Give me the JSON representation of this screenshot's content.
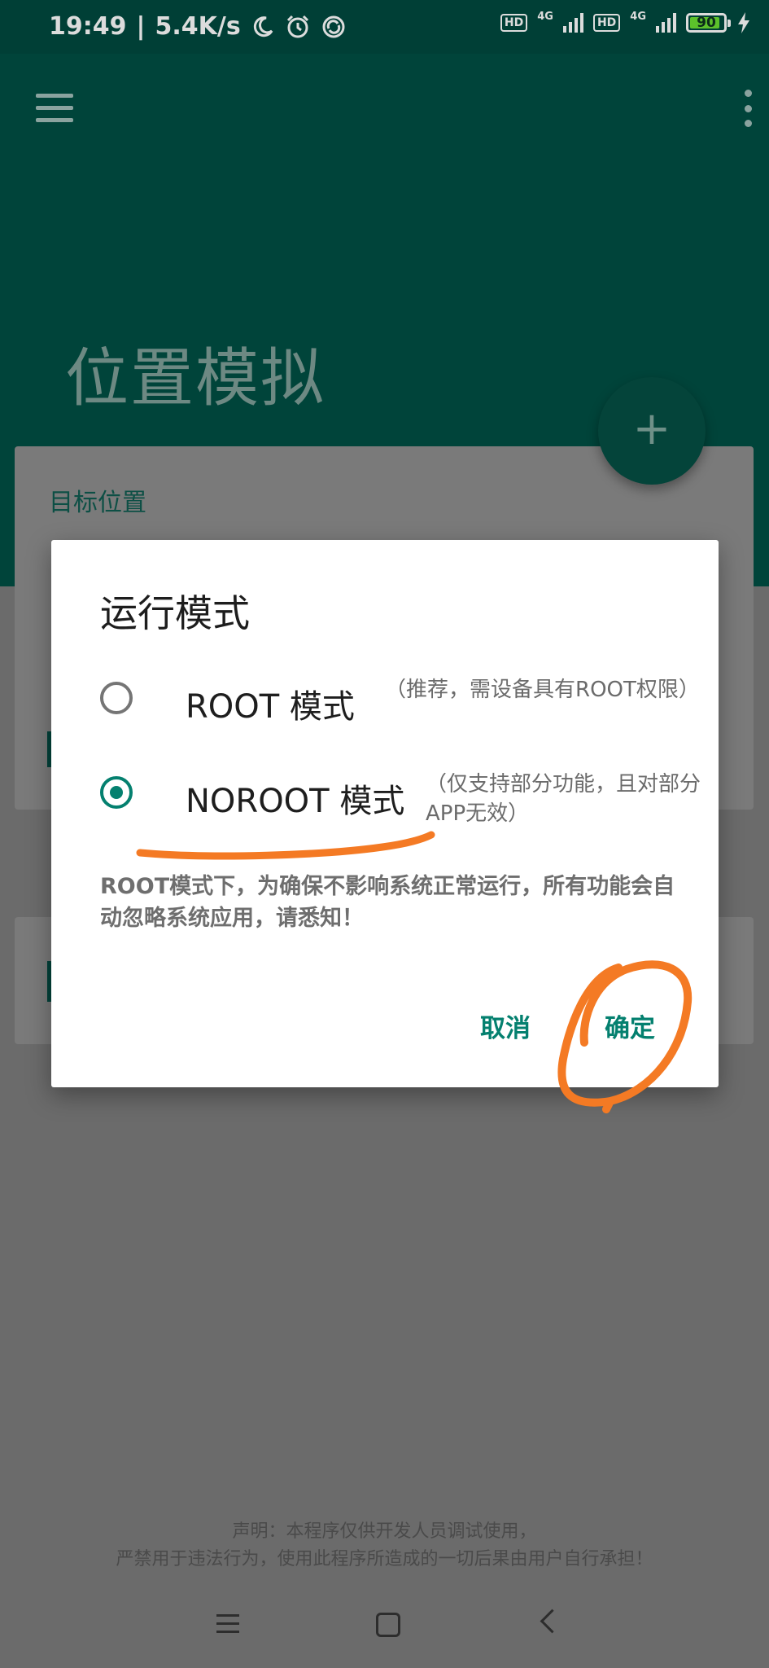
{
  "status_bar": {
    "time": "19:49",
    "speed": "5.4K/s",
    "sim1_badge": "HD",
    "sim1_net": "4G",
    "sim2_badge": "HD",
    "sim2_net": "4G",
    "battery": "90",
    "battery_level": 0.9,
    "icons": [
      "moon-icon",
      "alarm-icon",
      "sync-icon",
      "charging-icon"
    ]
  },
  "appbar": {
    "title": "位置模拟",
    "menu_icon": "hamburger-menu-icon",
    "more_icon": "more-vert-icon"
  },
  "card": {
    "title": "目标位置"
  },
  "fab": {
    "label": "+"
  },
  "dialog": {
    "title": "运行模式",
    "options": [
      {
        "label": "ROOT 模式",
        "desc": "（推荐，需设备具有ROOT权限）",
        "checked": false
      },
      {
        "label": "NOROOT 模式",
        "desc": "（仅支持部分功能，且对部分APP无效）",
        "checked": true
      }
    ],
    "note": "ROOT模式下，为确保不影响系统正常运行，所有功能会自动忽略系统应用，请悉知！",
    "cancel_label": "取消",
    "ok_label": "确定"
  },
  "disclaimer": {
    "line1": "声明：本程序仅供开发人员调试使用，",
    "line2": "严禁用于违法行为，使用此程序所造成的一切后果由用户自行承担！"
  },
  "colors": {
    "primary": "#00443a",
    "accent": "#04806f",
    "annotation": "#f47a24"
  }
}
